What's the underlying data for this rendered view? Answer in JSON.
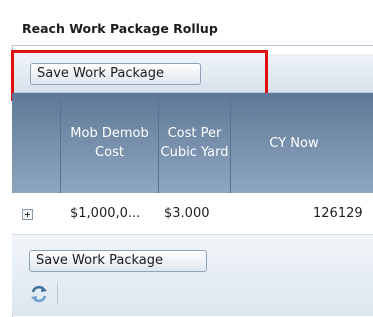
{
  "panel": {
    "title": "Reach Work Package Rollup"
  },
  "toolbar": {
    "save_label": "Save Work Package"
  },
  "grid": {
    "columns": [
      {
        "label": ""
      },
      {
        "label": "Mob Demob Cost"
      },
      {
        "label": "Cost Per Cubic Yard"
      },
      {
        "label": "CY Now"
      }
    ],
    "rows": [
      {
        "mob_demob_cost": "$1,000,0...",
        "cost_per_cy": "$3.000",
        "cy_now": "126129"
      }
    ]
  },
  "footer": {
    "save_label": "Save Work Package",
    "refresh_icon": "refresh-icon"
  },
  "colors": {
    "header_bg": "#6f87a5",
    "highlight": "#e01010",
    "toolbar_bg": "#dfe7ef"
  }
}
